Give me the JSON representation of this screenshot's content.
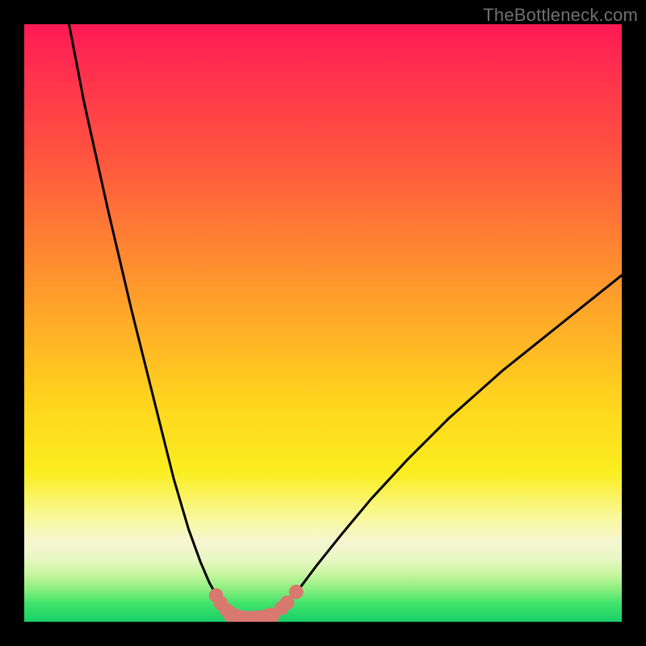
{
  "watermark": "TheBottleneck.com",
  "chart_data": {
    "type": "line",
    "title": "",
    "xlabel": "",
    "ylabel": "",
    "xlim": [
      0,
      100
    ],
    "ylim": [
      0,
      100
    ],
    "grid": false,
    "legend": false,
    "series": [
      {
        "name": "left-curve",
        "x": [
          7.5,
          10,
          14,
          18,
          22,
          25,
          27.5,
          29.5,
          31,
          32.3,
          33.4,
          34.3,
          34.8
        ],
        "y": [
          100,
          87,
          69,
          52,
          36,
          24,
          15.5,
          10,
          6.5,
          4.2,
          2.6,
          1.4,
          0.9
        ]
      },
      {
        "name": "floor",
        "x": [
          34.8,
          36,
          37.5,
          39,
          40.5,
          41.8
        ],
        "y": [
          0.9,
          0.55,
          0.45,
          0.46,
          0.6,
          1.0
        ]
      },
      {
        "name": "right-curve",
        "x": [
          41.8,
          43.5,
          46,
          49,
          53,
          58,
          64,
          71,
          80,
          90,
          100
        ],
        "y": [
          1.0,
          2.6,
          5.5,
          9.5,
          14.5,
          20.5,
          27,
          34,
          42,
          50,
          58
        ]
      }
    ],
    "markers": {
      "name": "highlighted-points",
      "color": "#d9786f",
      "points": [
        {
          "x": 32.1,
          "y": 4.4,
          "r": 1.2
        },
        {
          "x": 32.9,
          "y": 3.1,
          "r": 1.2
        },
        {
          "x": 33.9,
          "y": 1.9,
          "r": 1.2
        },
        {
          "x": 34.7,
          "y": 1.15,
          "r": 1.35
        },
        {
          "x": 35.6,
          "y": 0.75,
          "r": 1.35
        },
        {
          "x": 36.5,
          "y": 0.55,
          "r": 1.35
        },
        {
          "x": 37.5,
          "y": 0.48,
          "r": 1.35
        },
        {
          "x": 38.5,
          "y": 0.5,
          "r": 1.35
        },
        {
          "x": 39.5,
          "y": 0.6,
          "r": 1.35
        },
        {
          "x": 40.5,
          "y": 0.78,
          "r": 1.35
        },
        {
          "x": 41.4,
          "y": 1.05,
          "r": 1.35
        },
        {
          "x": 43.1,
          "y": 2.3,
          "r": 1.2
        },
        {
          "x": 44.0,
          "y": 3.2,
          "r": 1.2
        },
        {
          "x": 45.5,
          "y": 5.0,
          "r": 1.2
        }
      ]
    },
    "background": {
      "type": "vertical-gradient",
      "stops": [
        {
          "pos": 0,
          "color": "#ff1a54"
        },
        {
          "pos": 50,
          "color": "#ffab28"
        },
        {
          "pos": 80,
          "color": "#f8f57a"
        },
        {
          "pos": 100,
          "color": "#18cf69"
        }
      ]
    }
  }
}
